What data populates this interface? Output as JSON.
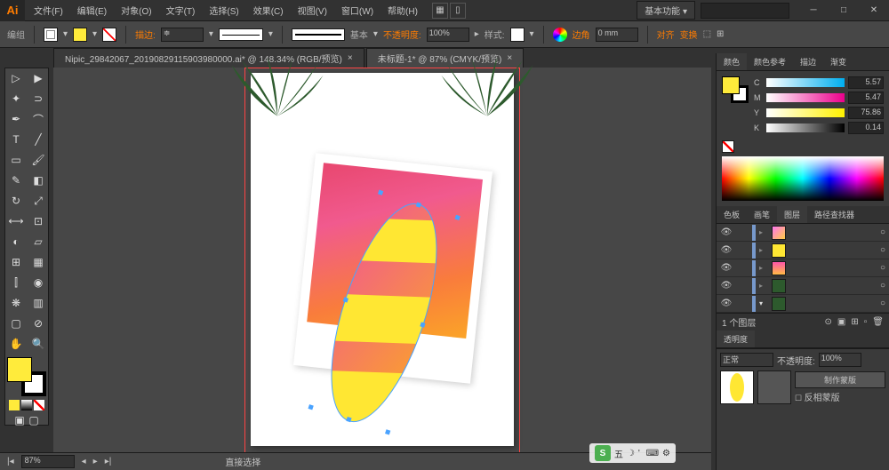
{
  "menu": {
    "file": "文件(F)",
    "edit": "编辑(E)",
    "object": "对象(O)",
    "type": "文字(T)",
    "select": "选择(S)",
    "effect": "效果(C)",
    "view": "视图(V)",
    "window": "窗口(W)",
    "help": "帮助(H)"
  },
  "workspace_label": "基本功能",
  "control": {
    "group": "编组",
    "stroke": "描边:",
    "basic": "基本",
    "opacity": "不透明度:",
    "opacity_val": "100%",
    "style": "样式:",
    "align": "边角",
    "align_val": "0 mm",
    "align_l": "对齐",
    "transform": "变换"
  },
  "tabs": [
    {
      "label": "Nipic_29842067_20190829115903980000.ai* @ 148.34% (RGB/预览)",
      "active": false
    },
    {
      "label": "未标题-1* @ 87% (CMYK/预览)",
      "active": true
    }
  ],
  "color_panel": {
    "tab1": "颜色",
    "tab2": "颜色参考",
    "tab3": "描边",
    "tab4": "渐变",
    "c": "5.57",
    "m": "5.47",
    "y": "75.86",
    "k": "0.14"
  },
  "layers": {
    "tab1": "色板",
    "tab2": "画笔",
    "tab3": "图层",
    "tab4": "路径查找器",
    "count": "1 个图层",
    "rows": 5
  },
  "transparency": {
    "tab": "透明度",
    "mode": "正常",
    "opacity_label": "不透明度:",
    "opacity": "100%",
    "mask": "制作蒙版",
    "clip": "反相蒙版"
  },
  "status": {
    "zoom": "87%",
    "tool": "直接选择"
  },
  "ime": {
    "s": "S",
    "txt": "五"
  },
  "chart_data": null
}
